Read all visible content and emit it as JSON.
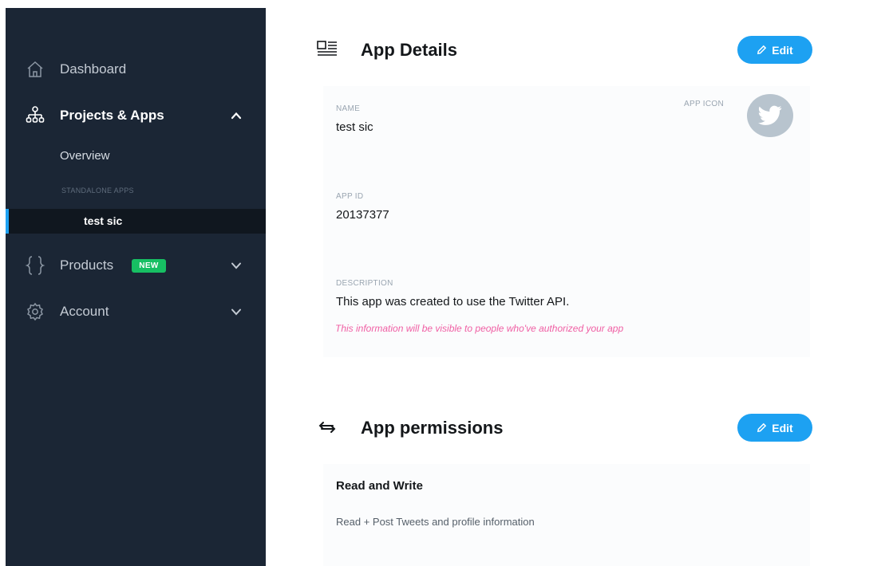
{
  "sidebar": {
    "items": [
      {
        "label": "Dashboard",
        "icon": "home-icon"
      },
      {
        "label": "Projects & Apps",
        "icon": "org-chart-icon"
      },
      {
        "label": "Products",
        "icon": "braces-icon",
        "badge": "NEW"
      },
      {
        "label": "Account",
        "icon": "gear-icon"
      }
    ],
    "sub": {
      "overview": "Overview",
      "section_caption": "STANDALONE APPS",
      "active_app": "test sic"
    }
  },
  "app_details": {
    "title": "App Details",
    "edit_label": "Edit",
    "name_label": "NAME",
    "name_value": "test sic",
    "icon_label": "APP ICON",
    "id_label": "APP ID",
    "id_value": "20137377",
    "description_label": "DESCRIPTION",
    "description_value": "This app was created to use the Twitter API.",
    "visibility_note": "This information will be visible to people who've authorized your app"
  },
  "app_permissions": {
    "title": "App permissions",
    "edit_label": "Edit",
    "level": "Read and Write",
    "level_description": "Read + Post Tweets and profile information"
  },
  "colors": {
    "sidebar_bg": "#1b2635",
    "accent": "#1da1f2",
    "badge_green": "#17bf63",
    "note_pink": "#f05fa4"
  }
}
